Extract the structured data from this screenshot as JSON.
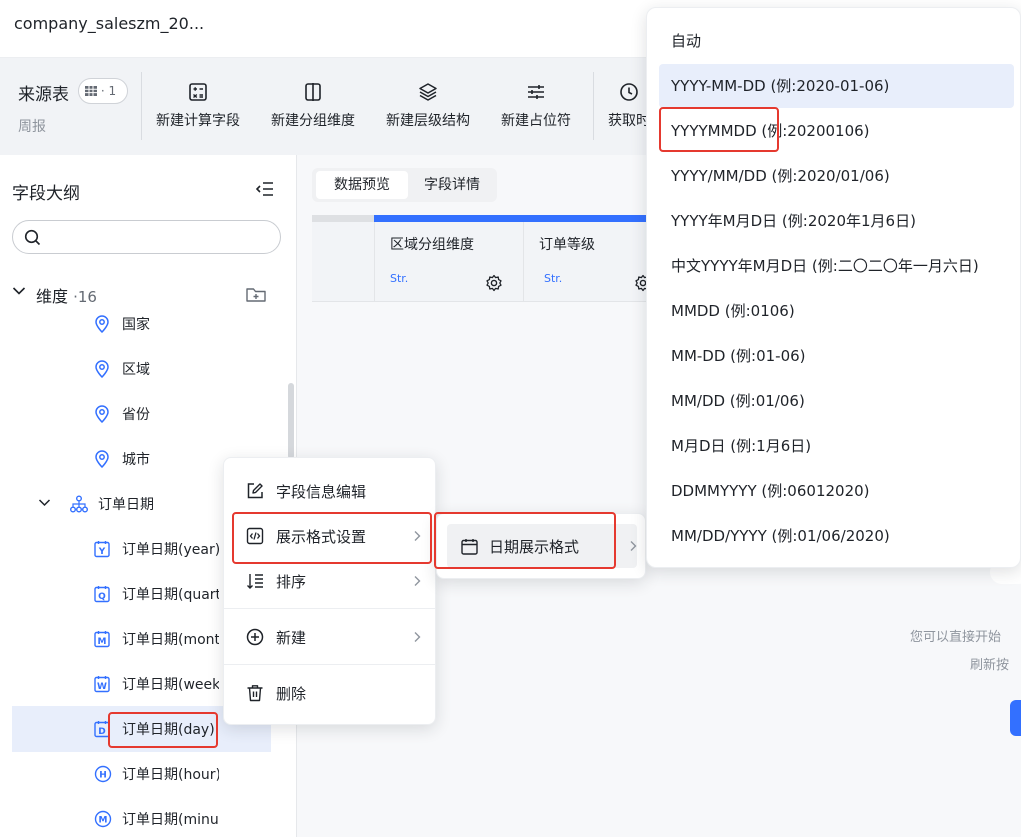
{
  "window": {
    "title": "company_saleszm_20..."
  },
  "toolbar": {
    "source_label": "来源表",
    "source_count": "· 1",
    "source_sub": "周报",
    "buttons": [
      {
        "label": "新建计算字段",
        "icon": "calc-field-icon"
      },
      {
        "label": "新建分组维度",
        "icon": "group-dimension-icon"
      },
      {
        "label": "新建层级结构",
        "icon": "layers-icon"
      },
      {
        "label": "新建占位符",
        "icon": "sliders-icon"
      },
      {
        "label": "获取时",
        "icon": "clock-icon"
      }
    ]
  },
  "sidebar": {
    "title": "字段大纲",
    "search_placeholder": "",
    "dimension_group": {
      "label": "维度",
      "count": "·16"
    },
    "fields": [
      {
        "label": "国家",
        "icon": "location-pin-icon"
      },
      {
        "label": "区域",
        "icon": "location-pin-icon"
      },
      {
        "label": "省份",
        "icon": "location-pin-icon"
      },
      {
        "label": "城市",
        "icon": "location-pin-icon"
      },
      {
        "label": "订单日期",
        "icon": "hierarchy-icon"
      },
      {
        "label": "订单日期(year)",
        "icon": "date-y-icon"
      },
      {
        "label": "订单日期(quarter)",
        "icon": "date-q-icon"
      },
      {
        "label": "订单日期(month)",
        "icon": "date-m-icon"
      },
      {
        "label": "订单日期(week)",
        "icon": "date-w-icon"
      },
      {
        "label": "订单日期(day)",
        "icon": "date-d-icon"
      },
      {
        "label": "订单日期(hour)",
        "icon": "date-h-icon"
      },
      {
        "label": "订单日期(minute)",
        "icon": "date-m-icon"
      }
    ]
  },
  "main": {
    "tabs": [
      "数据预览",
      "字段详情"
    ],
    "columns": [
      {
        "header": "区域分组维度",
        "type": "Str."
      },
      {
        "header": "订单等级",
        "type": "Str."
      }
    ],
    "hint_line1": "您可以直接开始",
    "hint_line2": "刷新按"
  },
  "context_menu": {
    "items": [
      "字段信息编辑",
      "展示格式设置",
      "排序",
      "新建",
      "删除"
    ],
    "submenu_item": "日期展示格式"
  },
  "date_formats": {
    "options": [
      "自动",
      "YYYY-MM-DD (例:2020-01-06)",
      "YYYYMMDD (例:20200106)",
      "YYYY/MM/DD (例:2020/01/06)",
      "YYYY年M月D日 (例:2020年1月6日)",
      "中文YYYY年M月D日 (例:二〇二〇年一月六日)",
      "MMDD (例:0106)",
      "MM-DD (例:01-06)",
      "MM/DD (例:01/06)",
      "M月D日 (例:1月6日)",
      "DDMMYYYY (例:06012020)",
      "MM/DD/YYYY (例:01/06/2020)"
    ],
    "highlighted": "YYYY-MM-DD (例:2020-01-06)"
  },
  "colors": {
    "accent": "#3370ff",
    "highlight_box": "#e5392f",
    "selected_row": "#e8eefb"
  }
}
